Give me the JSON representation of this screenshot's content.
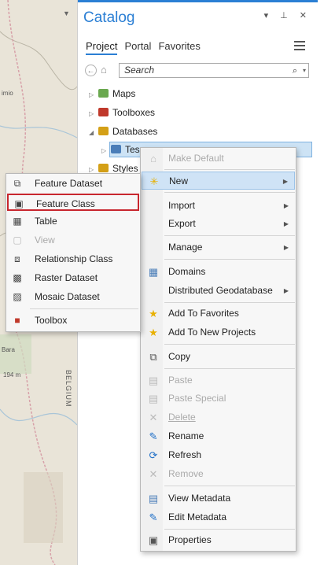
{
  "map": {
    "place1": "imio",
    "place2": "Bara",
    "place3": "194 m",
    "vertical": "BELGIUM"
  },
  "catalog": {
    "title": "Catalog",
    "controls": "▾ ⊥ ✕",
    "tabs": [
      "Project",
      "Portal",
      "Favorites"
    ],
    "search_placeholder": "Search",
    "tree": [
      {
        "label": "Maps",
        "color": "#6aa84f"
      },
      {
        "label": "Toolboxes",
        "color": "#c0392b"
      },
      {
        "label": "Databases",
        "color": "#d4a017"
      },
      {
        "label": "Tes",
        "color": "#4a7db8"
      },
      {
        "label": "Styles",
        "color": "#d4a017"
      }
    ]
  },
  "context_menu": {
    "items": [
      {
        "label": "Make Default",
        "icon": "home-icon",
        "disabled": true
      },
      {
        "label": "New",
        "icon": "star-burst-icon",
        "submenu": true,
        "highlighted": true
      },
      {
        "label": "Import",
        "submenu": true
      },
      {
        "label": "Export",
        "submenu": true
      },
      {
        "label": "Manage",
        "submenu": true
      },
      {
        "label": "Domains",
        "icon": "domains-icon"
      },
      {
        "label": "Distributed Geodatabase",
        "submenu": true
      },
      {
        "label": "Add To Favorites",
        "icon": "star-icon"
      },
      {
        "label": "Add To New Projects",
        "icon": "star-icon"
      },
      {
        "label": "Copy",
        "icon": "copy-icon"
      },
      {
        "label": "Paste",
        "icon": "paste-icon",
        "disabled": true
      },
      {
        "label": "Paste Special",
        "icon": "paste-icon",
        "disabled": true
      },
      {
        "label": "Delete",
        "icon": "x-icon",
        "disabled": true
      },
      {
        "label": "Rename",
        "icon": "pencil-icon"
      },
      {
        "label": "Refresh",
        "icon": "refresh-icon"
      },
      {
        "label": "Remove",
        "icon": "x-icon",
        "disabled": true
      },
      {
        "label": "View Metadata",
        "icon": "document-icon"
      },
      {
        "label": "Edit Metadata",
        "icon": "pencil-icon"
      },
      {
        "label": "Properties",
        "icon": "properties-icon"
      }
    ]
  },
  "new_submenu": {
    "items": [
      {
        "label": "Feature Dataset",
        "icon": "feature-dataset-icon"
      },
      {
        "label": "Feature Class",
        "icon": "feature-class-icon",
        "outlined": true
      },
      {
        "label": "Table",
        "icon": "table-icon"
      },
      {
        "label": "View",
        "icon": "view-icon",
        "disabled": true
      },
      {
        "label": "Relationship Class",
        "icon": "relationship-class-icon"
      },
      {
        "label": "Raster Dataset",
        "icon": "raster-dataset-icon"
      },
      {
        "label": "Mosaic Dataset",
        "icon": "mosaic-dataset-icon"
      },
      {
        "label": "Toolbox",
        "icon": "toolbox-icon"
      }
    ]
  }
}
